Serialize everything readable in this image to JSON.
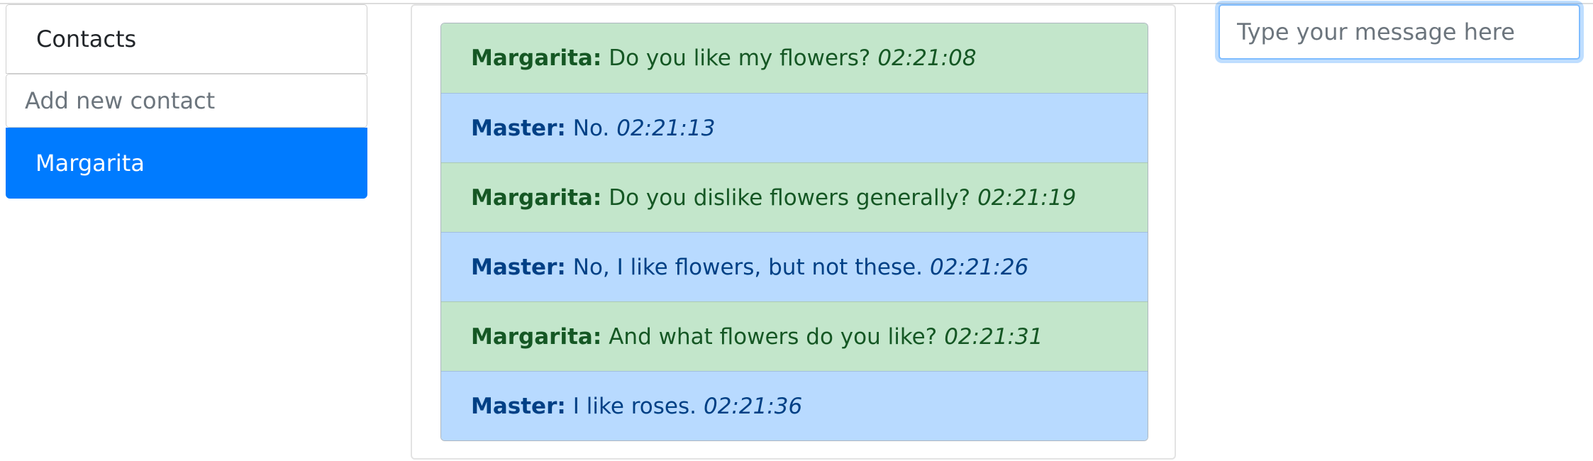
{
  "contacts": {
    "header": "Contacts",
    "new_contact_placeholder": "Add new contact",
    "items": [
      {
        "label": "Margarita"
      }
    ]
  },
  "chat": {
    "messages": [
      {
        "author": "Margarita:",
        "text": "Do you like my flowers?",
        "time": "02:21:08",
        "color": "#c3e6cb"
      },
      {
        "author": "Master:",
        "text": "No.",
        "time": "02:21:13",
        "color": "#b8daff"
      },
      {
        "author": "Margarita:",
        "text": "Do you dislike flowers generally?",
        "time": "02:21:19",
        "color": "#c3e6cb"
      },
      {
        "author": "Master:",
        "text": "No, I like flowers, but not these.",
        "time": "02:21:26",
        "color": "#b8daff"
      },
      {
        "author": "Margarita:",
        "text": "And what flowers do you like?",
        "time": "02:21:31",
        "color": "#c3e6cb"
      },
      {
        "author": "Master:",
        "text": "I like roses.",
        "time": "02:21:36",
        "color": "#b8daff"
      }
    ]
  },
  "composer": {
    "placeholder": "Type your message here"
  },
  "colors": {
    "accent": "#007bff",
    "incoming_bg": "#c3e6cb",
    "outgoing_bg": "#b8daff"
  }
}
